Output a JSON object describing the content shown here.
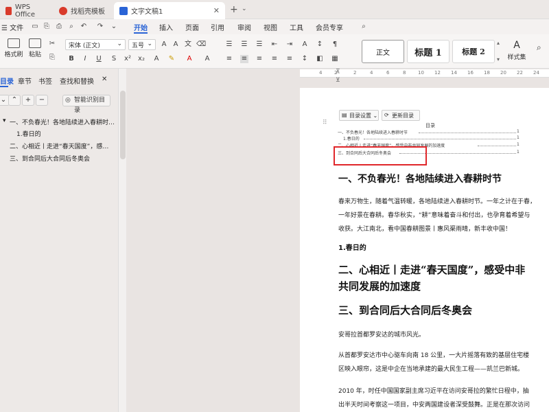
{
  "tabs": [
    {
      "label": "WPS Office",
      "color": "#d93b2b"
    },
    {
      "label": "找稻壳模板",
      "color": "#d93b2b"
    },
    {
      "label": "文字文稿1",
      "color": "#2a64d6"
    }
  ],
  "menu": {
    "file": "文件",
    "items": [
      "开始",
      "插入",
      "页面",
      "引用",
      "审阅",
      "视图",
      "工具",
      "会员专享"
    ],
    "active": "开始"
  },
  "ribbon": {
    "format_painter": "格式刷",
    "paste": "粘贴",
    "font": "宋体 (正文)",
    "size": "五号",
    "styles": {
      "normal": "正文",
      "h1": "标题 1",
      "h2": "标题 2",
      "style_set": "样式集"
    },
    "bold": "B",
    "italic": "I",
    "underline": "U"
  },
  "nav": {
    "tabs": [
      "目录",
      "章节",
      "书签",
      "查找和替换"
    ],
    "active": "目录",
    "smart_btn": "智能识别目录",
    "items": [
      "一、不负春光！各地陆续进入春耕时…",
      "1.春日的",
      "二、心相近丨走进“春天国度”，感…",
      "三、到合同后大合同后冬奥会"
    ]
  },
  "ruler": [
    "4",
    "2",
    "2",
    "4",
    "6",
    "8",
    "10",
    "12",
    "14",
    "16",
    "18",
    "20",
    "22",
    "24"
  ],
  "toc": {
    "settings_btn": "目录设置",
    "update_btn": "更新目录",
    "heading": "目录",
    "lines": [
      {
        "text": "一、不负春光！各地陆续进入春耕时节",
        "page": "1"
      },
      {
        "text": "1.春日的",
        "page": "1"
      },
      {
        "text": "二、心相近丨走进“春天国度”，感受中非共同发展的加速度",
        "page": "1"
      },
      {
        "text": "三、到合同后大合同后冬奥会",
        "page": "1"
      }
    ]
  },
  "doc": {
    "h1": "一、不负春光！各地陆续进入春耕时节",
    "p1": [
      "春来万物生，随着气温转暖，各地陆续进入春耕时节。一年之计在于春，",
      "一年好景在春耕。春华秋实，“耕”意味着奋斗和付出，也孕育着希望与",
      "收获。大江南北，看中国春耕图景丨惠风渠雨晴，新丰收中国！"
    ],
    "sub1": "1.春日的",
    "h2_line1": "二、心相近丨走进“春天国度”，感受中非",
    "h2_line2": "共同发展的加速度",
    "h3": "三、到合同后大合同后冬奥会",
    "p2": "安哥拉首都罗安达的城市风光。",
    "p3": [
      "从首都罗安达市中心驱车向南 18 公里，一大片摇落有致的基层住宅楼",
      "区映入眼帘，这是中企在当地承建的最大民生工程——凯兰巴新城。"
    ],
    "p4": [
      "2010 年，时任中国国家副主席习近平在访问安哥拉的繁忙日程中，抽",
      "出半天时间考察这一项目，中安两国建设者深受鼓舞。正是在那次访问"
    ]
  }
}
